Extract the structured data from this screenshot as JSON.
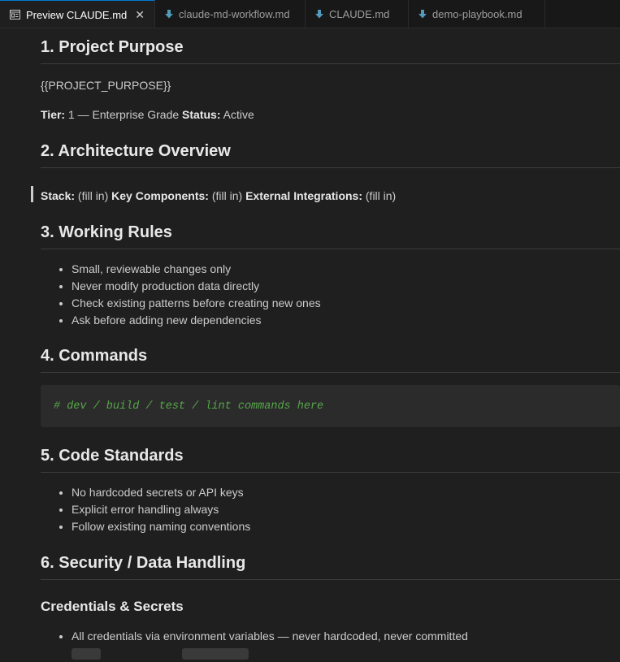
{
  "tabs": [
    {
      "label": "Preview CLAUDE.md",
      "icon": "preview-icon",
      "active": true
    },
    {
      "label": "claude-md-workflow.md",
      "icon": "markdown-file-icon"
    },
    {
      "label": "CLAUDE.md",
      "icon": "markdown-file-icon"
    },
    {
      "label": "demo-playbook.md",
      "icon": "markdown-file-icon"
    }
  ],
  "close_glyph": "✕",
  "doc": {
    "s1_title": "1. Project Purpose",
    "s1_placeholder": "{{PROJECT_PURPOSE}}",
    "tier_label": "Tier:",
    "tier_value": " 1 — Enterprise Grade ",
    "status_label": "Status:",
    "status_value": " Active",
    "s2_title": "2. Architecture Overview",
    "stack_label": "Stack:",
    "stack_value": " (fill in) ",
    "components_label": "Key Components:",
    "components_value": " (fill in) ",
    "integrations_label": "External Integrations:",
    "integrations_value": " (fill in)",
    "s3_title": "3. Working Rules",
    "rules": [
      "Small, reviewable changes only",
      "Never modify production data directly",
      "Check existing patterns before creating new ones",
      "Ask before adding new dependencies"
    ],
    "s4_title": "4. Commands",
    "commands_code": "# dev / build / test / lint commands here",
    "s5_title": "5. Code Standards",
    "standards": [
      "No hardcoded secrets or API keys",
      "Explicit error handling always",
      "Follow existing naming conventions"
    ],
    "s6_title": "6. Security / Data Handling",
    "s6_sub": "Credentials & Secrets",
    "credentials": [
      "All credentials via environment variables — never hardcoded, never committed"
    ]
  }
}
